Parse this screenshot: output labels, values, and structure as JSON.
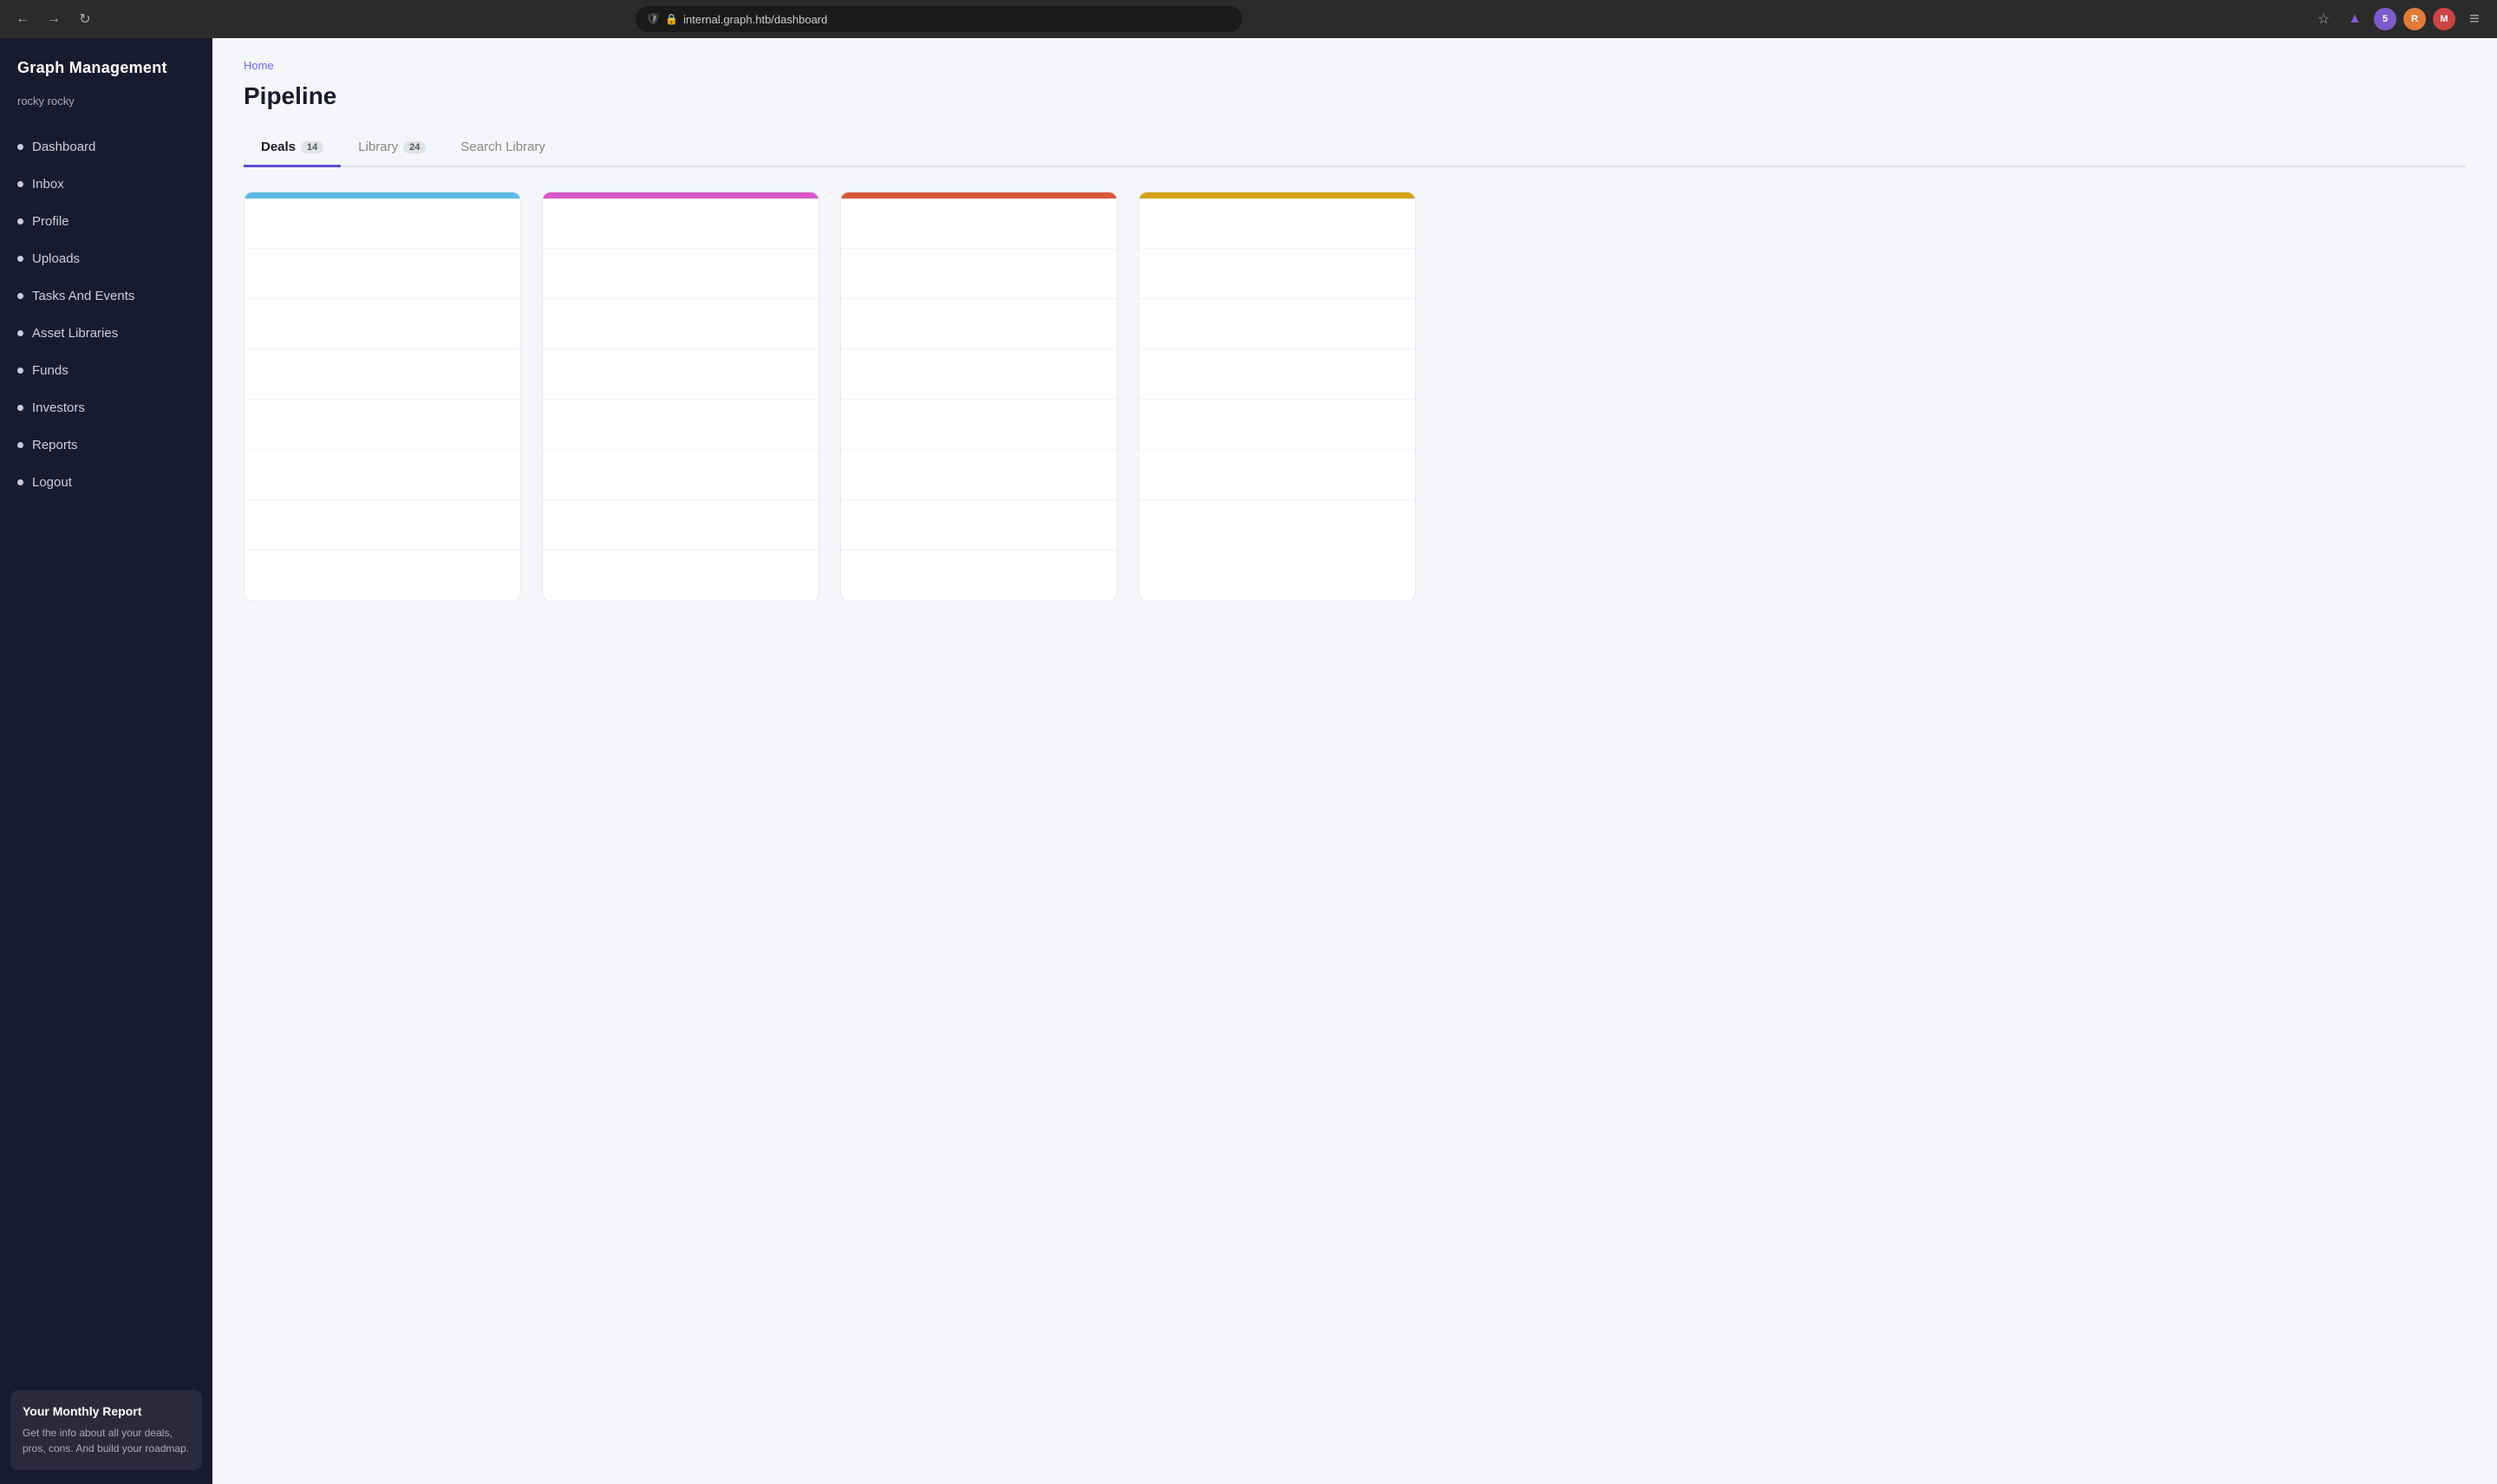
{
  "browser": {
    "back_icon": "←",
    "forward_icon": "→",
    "refresh_icon": "↻",
    "url": "internal.graph.htb/dashboard",
    "star_icon": "☆",
    "badge_count": "5",
    "shield_icon": "🛡",
    "lock_icon": "🔒"
  },
  "sidebar": {
    "logo": "Graph Management",
    "user": "rocky rocky",
    "nav_items": [
      {
        "label": "Dashboard",
        "id": "dashboard"
      },
      {
        "label": "Inbox",
        "id": "inbox"
      },
      {
        "label": "Profile",
        "id": "profile"
      },
      {
        "label": "Uploads",
        "id": "uploads"
      },
      {
        "label": "Tasks And Events",
        "id": "tasks"
      },
      {
        "label": "Asset Libraries",
        "id": "asset-libraries"
      },
      {
        "label": "Funds",
        "id": "funds"
      },
      {
        "label": "Investors",
        "id": "investors"
      },
      {
        "label": "Reports",
        "id": "reports"
      },
      {
        "label": "Logout",
        "id": "logout"
      }
    ],
    "promo": {
      "title": "Your Monthly Report",
      "text": "Get the info about all your deals, pros, cons. And build your roadmap."
    }
  },
  "breadcrumb": "Home",
  "page_title": "Pipeline",
  "tabs": [
    {
      "label": "Deals",
      "badge": "14",
      "active": true,
      "id": "deals"
    },
    {
      "label": "Library",
      "badge": "24",
      "active": false,
      "id": "library"
    },
    {
      "label": "Search Library",
      "badge": "",
      "active": false,
      "id": "search-library"
    }
  ],
  "kanban": {
    "columns": [
      {
        "color": "blue",
        "cards": 8
      },
      {
        "color": "pink",
        "cards": 8
      },
      {
        "color": "orange",
        "cards": 8
      },
      {
        "color": "yellow",
        "cards": 7
      }
    ]
  }
}
